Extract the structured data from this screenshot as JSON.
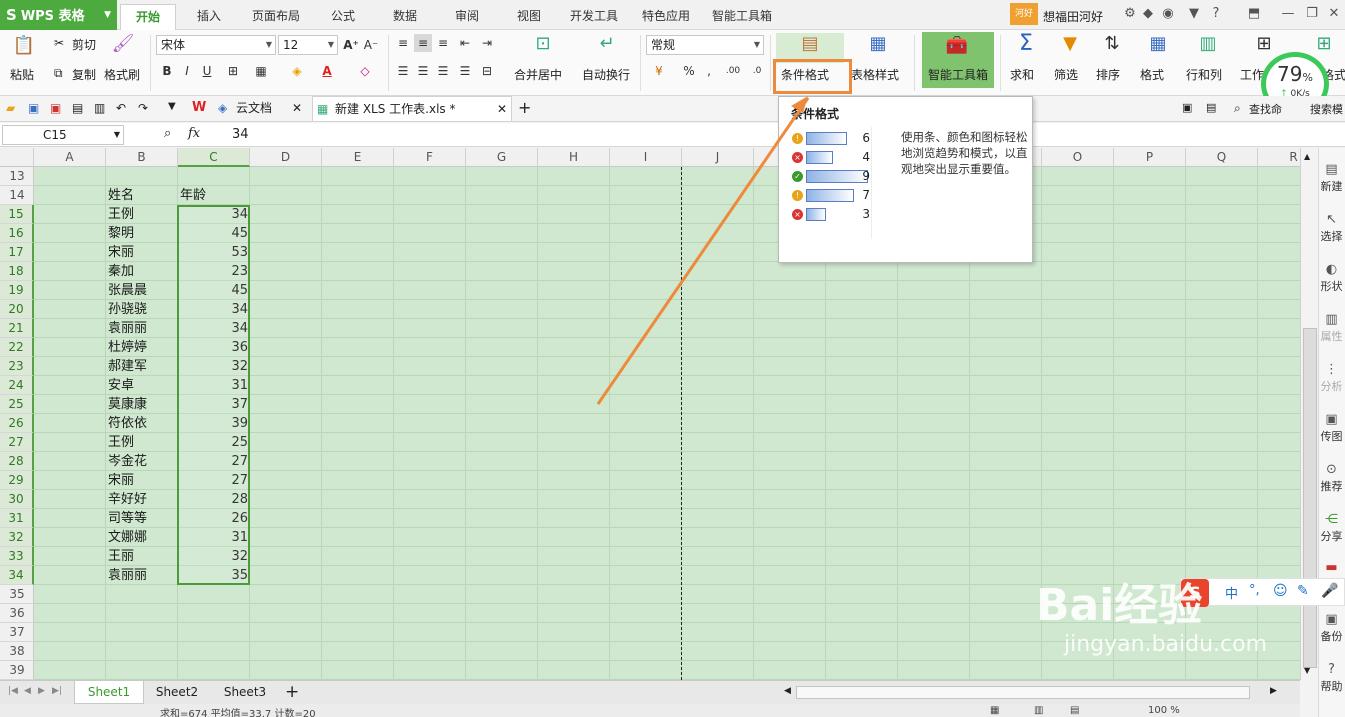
{
  "app": {
    "logo": "WPS 表格",
    "logo_letter": "S"
  },
  "ribbon_tabs": [
    "开始",
    "插入",
    "页面布局",
    "公式",
    "数据",
    "审阅",
    "视图",
    "开发工具",
    "特色应用",
    "智能工具箱"
  ],
  "user": {
    "badge": "河好",
    "name": "想福田河好"
  },
  "clipboard": {
    "paste": "粘贴",
    "cut": "剪切",
    "copy": "复制",
    "format_painter": "格式刷"
  },
  "font": {
    "name": "宋体",
    "size": "12"
  },
  "number_format": "常规",
  "ribbon_buttons": {
    "merge_center": "合并居中",
    "wrap_text": "自动换行",
    "conditional_format": "条件格式",
    "table_style": "表格样式",
    "smart_toolbox": "智能工具箱",
    "sum": "求和",
    "filter": "筛选",
    "sort": "排序",
    "format": "格式",
    "row_col": "行和列",
    "worksheet": "工作表",
    "cut_right": "格式"
  },
  "doc_tabs": [
    {
      "label": "云文档"
    },
    {
      "label": "新建 XLS 工作表.xls *"
    }
  ],
  "doc_right": {
    "find": "查找命",
    "search": "搜索模"
  },
  "formula_bar": {
    "cell_ref": "C15",
    "fx": "fx",
    "value": "34"
  },
  "columns": [
    "A",
    "B",
    "C",
    "D",
    "E",
    "F",
    "G",
    "H",
    "I",
    "J",
    "K",
    "L",
    "M",
    "N",
    "O",
    "P",
    "Q",
    "R"
  ],
  "rows": [
    "13",
    "14",
    "15",
    "16",
    "17",
    "18",
    "19",
    "20",
    "21",
    "22",
    "23",
    "24",
    "25",
    "26",
    "27",
    "28",
    "29",
    "30",
    "31",
    "32",
    "33",
    "34",
    "35",
    "36",
    "37",
    "38",
    "39"
  ],
  "table": {
    "header_name": "姓名",
    "header_age": "年龄",
    "records": [
      {
        "name": "王例",
        "age": "34"
      },
      {
        "name": "黎明",
        "age": "45"
      },
      {
        "name": "宋丽",
        "age": "53"
      },
      {
        "name": "秦加",
        "age": "23"
      },
      {
        "name": "张晨晨",
        "age": "45"
      },
      {
        "name": "孙骁骁",
        "age": "34"
      },
      {
        "name": "袁丽丽",
        "age": "34"
      },
      {
        "name": "杜婷婷",
        "age": "36"
      },
      {
        "name": "郝建军",
        "age": "32"
      },
      {
        "name": "安卓",
        "age": "31"
      },
      {
        "name": "莫康康",
        "age": "37"
      },
      {
        "name": "符依依",
        "age": "39"
      },
      {
        "name": "王例",
        "age": "25"
      },
      {
        "name": "岑金花",
        "age": "27"
      },
      {
        "name": "宋丽",
        "age": "27"
      },
      {
        "name": "辛好好",
        "age": "28"
      },
      {
        "name": "司等等",
        "age": "26"
      },
      {
        "name": "文娜娜",
        "age": "31"
      },
      {
        "name": "王丽",
        "age": "32"
      },
      {
        "name": "袁丽丽",
        "age": "35"
      }
    ]
  },
  "tooltip": {
    "title": "条件格式",
    "description": "使用条、颜色和图标轻松地浏览趋势和模式，以直观地突出显示重要值。",
    "preview": [
      {
        "value": "6",
        "fill": 0.66,
        "icon": "warning"
      },
      {
        "value": "4",
        "fill": 0.44,
        "icon": "cross"
      },
      {
        "value": "9",
        "fill": 1.0,
        "icon": "check"
      },
      {
        "value": "7",
        "fill": 0.77,
        "icon": "warning"
      },
      {
        "value": "3",
        "fill": 0.33,
        "icon": "cross"
      }
    ]
  },
  "speed": {
    "percent": "79",
    "unit": "%",
    "rate": "0K/s"
  },
  "side_panel": [
    "新建",
    "选择",
    "形状",
    "属性",
    "分析",
    "传图",
    "推荐",
    "分享",
    "",
    "备份",
    "帮助"
  ],
  "sheets": [
    "Sheet1",
    "Sheet2",
    "Sheet3"
  ],
  "add_sheet": "+",
  "status": "求和=674  平均值=33.7  计数=20",
  "zoom": "100 %",
  "ime": {
    "lang": "中",
    "punct": "°,"
  },
  "watermark": {
    "brand": "Bai经验",
    "url": "jingyan.baidu.com"
  },
  "colors": {
    "accent": "#4caa3e",
    "grid_bg": "#cfe8cf",
    "highlight": "#ee8a3c",
    "speed_ring": "#3dc95a"
  }
}
